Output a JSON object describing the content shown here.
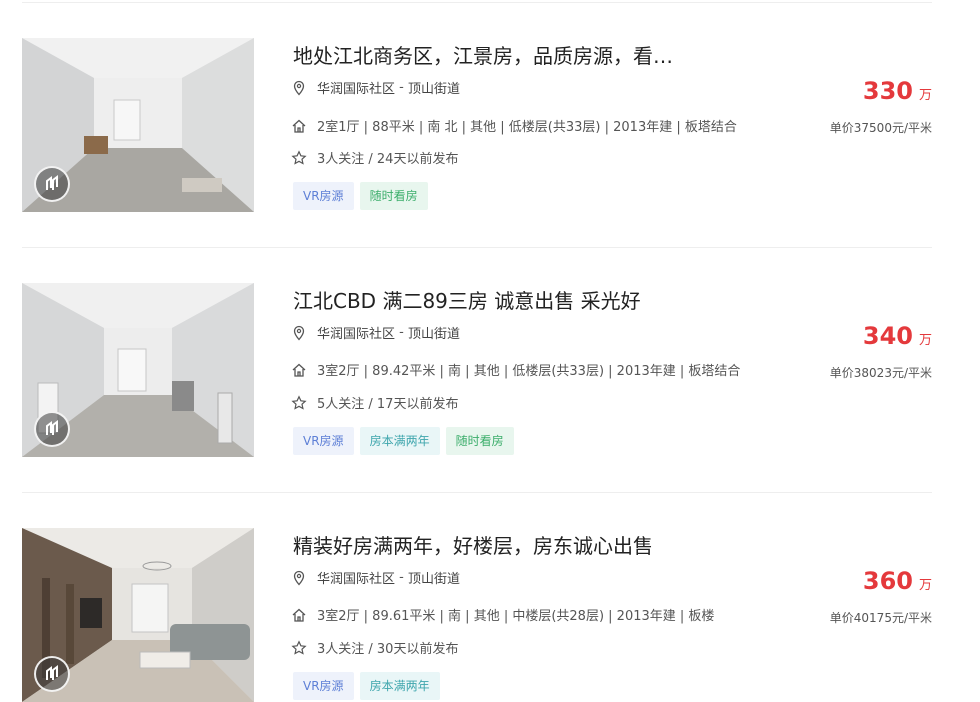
{
  "listings": [
    {
      "title": "地处江北商务区，江景房，品质房源，看…",
      "community": "华润国际社区",
      "area": "顶山街道",
      "info": "2室1厅 | 88平米 | 南 北 | 其他 | 低楼层(共33层) | 2013年建 | 板塔结合",
      "follow": "3人关注 / 24天以前发布",
      "tags": [
        "VR房源",
        "随时看房"
      ],
      "price": "330",
      "price_unit": "万",
      "unit_price": "单价37500元/平米"
    },
    {
      "title": "江北CBD 满二89三房 诚意出售 采光好",
      "community": "华润国际社区",
      "area": "顶山街道",
      "info": "3室2厅 | 89.42平米 | 南 | 其他 | 低楼层(共33层) | 2013年建 | 板塔结合",
      "follow": "5人关注 / 17天以前发布",
      "tags": [
        "VR房源",
        "房本满两年",
        "随时看房"
      ],
      "price": "340",
      "price_unit": "万",
      "unit_price": "单价38023元/平米"
    },
    {
      "title": "精装好房满两年，好楼层，房东诚心出售",
      "community": "华润国际社区",
      "area": "顶山街道",
      "info": "3室2厅 | 89.61平米 | 南 | 其他 | 中楼层(共28层) | 2013年建 | 板楼",
      "follow": "3人关注 / 30天以前发布",
      "tags": [
        "VR房源",
        "房本满两年"
      ],
      "price": "360",
      "price_unit": "万",
      "unit_price": "单价40175元/平米"
    }
  ],
  "separator": " - ",
  "icons": {
    "location": "location-pin-icon",
    "house": "house-icon",
    "follow": "star-icon",
    "vr": "vr-logo-icon"
  },
  "colors": {
    "price": "#e4393c",
    "tag_vr": "#5d7fd6",
    "tag_two_years": "#3fa6ad",
    "tag_anytime": "#3cae6b"
  }
}
